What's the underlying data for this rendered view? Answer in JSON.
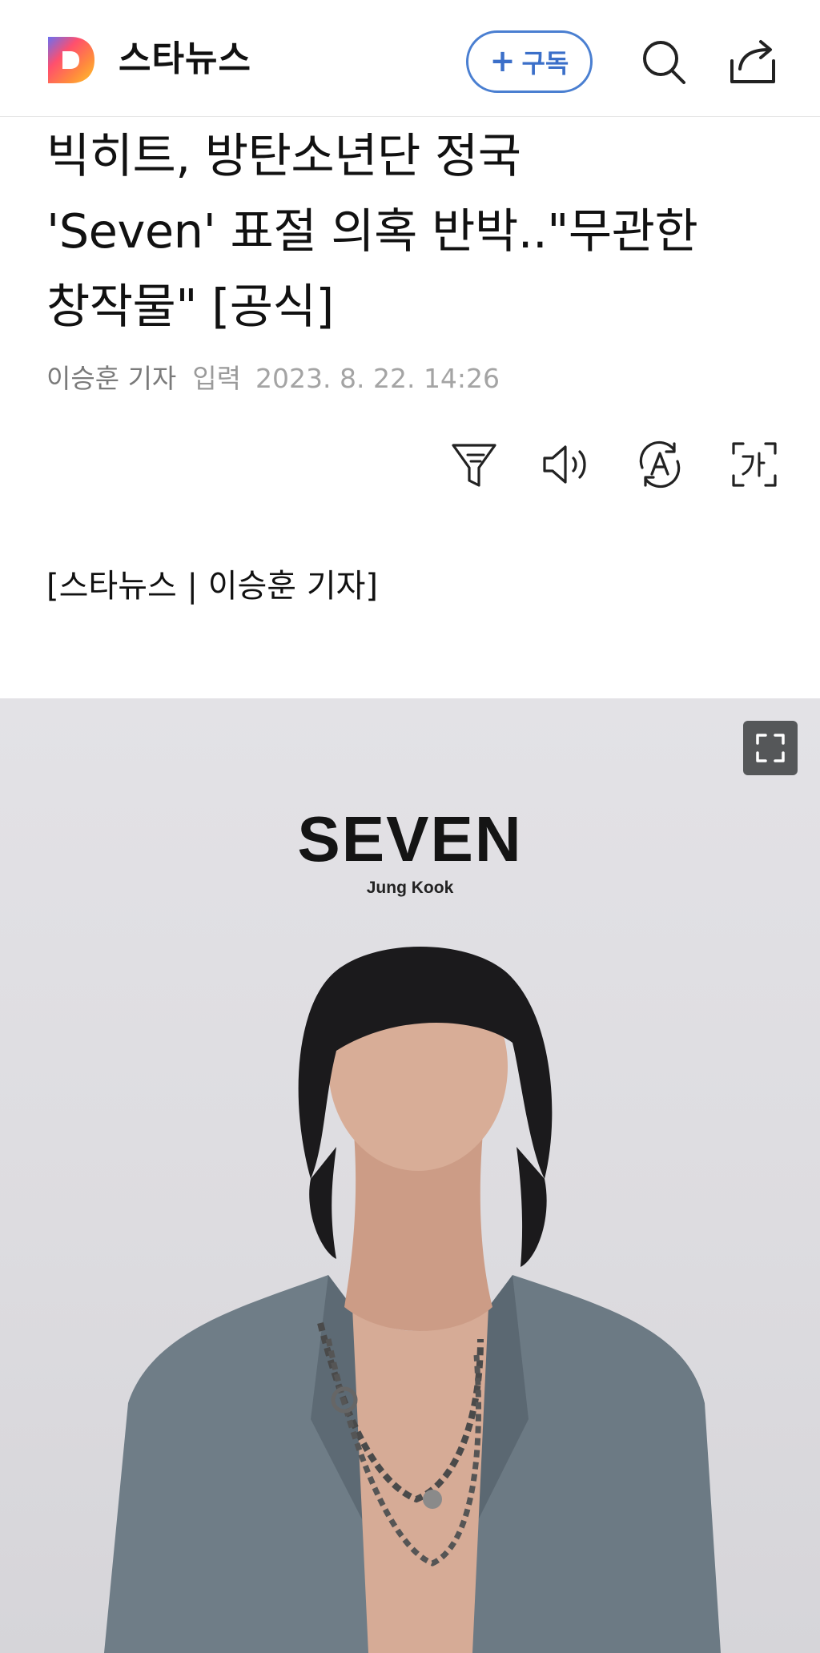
{
  "header": {
    "logo_icon": "daum-d-logo",
    "brand": "스타뉴스",
    "subscribe_label": "구독",
    "subscribe_plus": "+",
    "accent_color": "#4a7fd1"
  },
  "article": {
    "title_lines": [
      "빅히트, 방탄소년단 정국",
      "'Seven' 표절 의혹 반박..\"무관한",
      "창작물\" [공식]"
    ],
    "reporter": "이승훈 기자",
    "published_label": "입력",
    "published_time": "2023. 8. 22. 14:26",
    "tools": [
      "summary-icon",
      "read-aloud-icon",
      "translate-icon",
      "font-size-icon"
    ],
    "credit": "[스타뉴스 | 이승훈 기자]"
  },
  "photo": {
    "cover_title": "SEVEN",
    "cover_subtitle": "Jung Kook",
    "expand_icon": "expand-icon"
  }
}
